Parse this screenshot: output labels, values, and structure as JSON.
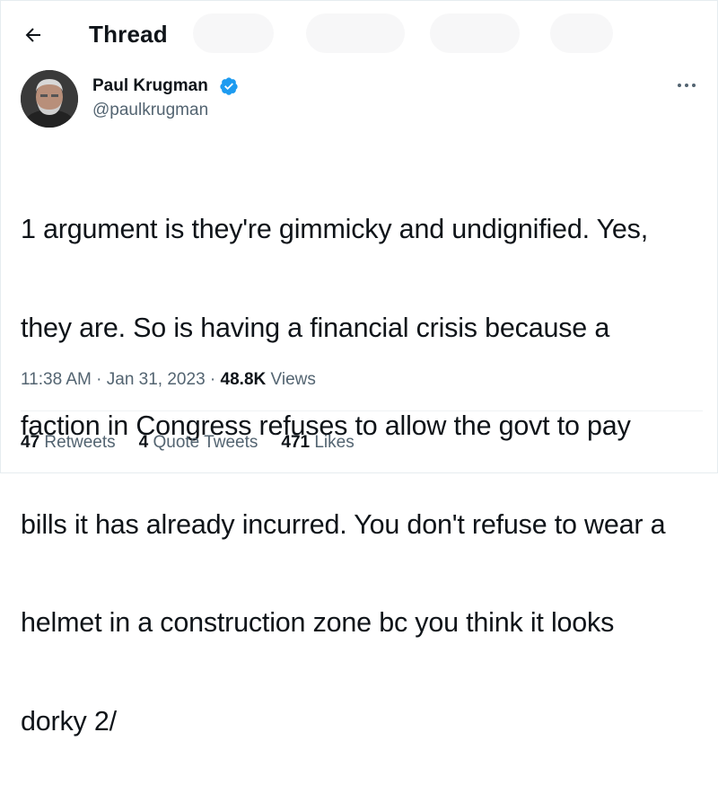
{
  "header": {
    "title": "Thread",
    "back_icon": "arrow-left-icon"
  },
  "author": {
    "name": "Paul Krugman",
    "handle": "@paulkrugman",
    "verified_icon": "verified-badge-icon",
    "verified_color": "#1d9bf0",
    "more_icon": "more-horizontal-icon"
  },
  "tweet": {
    "text_lines": [
      "1 argument is they're gimmicky and undignified. Yes,",
      "they are. So is having a financial crisis because a",
      "faction in Congress refuses to allow the govt to pay",
      "bills it has already incurred. You don't refuse to wear a",
      "helmet in a construction zone bc you think it looks",
      "dorky 2/"
    ]
  },
  "meta": {
    "time": "11:38 AM",
    "separator": "·",
    "date": "Jan 31, 2023",
    "views_count": "48.8K",
    "views_label": "Views"
  },
  "stats": {
    "retweets_count": "47",
    "retweets_label": "Retweets",
    "quotes_count": "4",
    "quotes_label": "Quote Tweets",
    "likes_count": "471",
    "likes_label": "Likes"
  },
  "colors": {
    "text": "#0f1419",
    "secondary": "#536471",
    "divider": "#eff3f4"
  }
}
